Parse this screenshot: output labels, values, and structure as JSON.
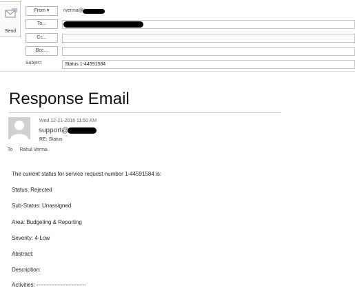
{
  "compose": {
    "send_label": "Send",
    "from_label": "From ▾",
    "from_value": "rverma@",
    "to_label": "To...",
    "cc_label": "Cc...",
    "bcc_label": "Bcc...",
    "subject_label": "Subject",
    "subject_value": "Status 1-44591584"
  },
  "heading": "Response Email",
  "email": {
    "date": "Wed 12-21-2016 11:50 AM",
    "from": "support@",
    "subject": "RE: Status",
    "to_label": "To",
    "to_name": "Rahul Verma",
    "body": [
      "The current status for service request number 1-44591584 is:",
      "Status: Rejected",
      "Sub-Status: Unassigned",
      "Area: Budgeting & Reporting",
      "Severity: 4-Low",
      "Abstract:",
      "Description:",
      "Activities: ---------------------------"
    ]
  }
}
